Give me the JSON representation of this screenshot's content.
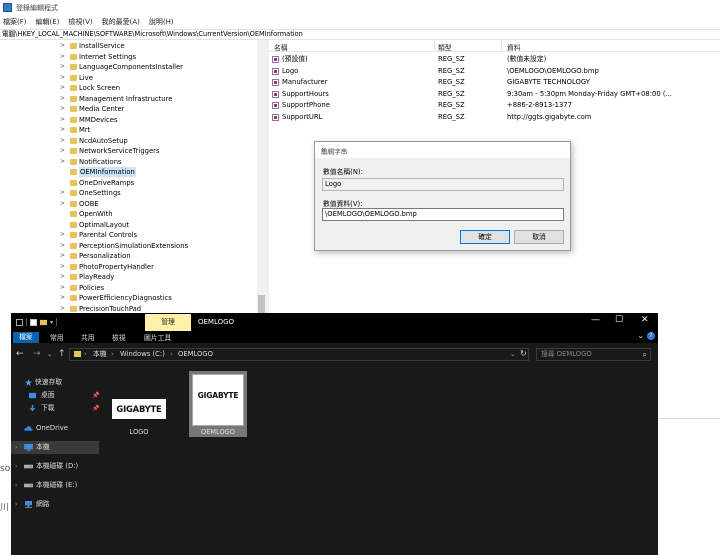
{
  "regedit": {
    "title": "登錄編輯程式",
    "menu": [
      "檔案(F)",
      "編輯(E)",
      "檢視(V)",
      "我的最愛(A)",
      "說明(H)"
    ],
    "address": "電腦\\HKEY_LOCAL_MACHINE\\SOFTWARE\\Microsoft\\Windows\\CurrentVersion\\OEMInformation",
    "tree": [
      {
        "label": "InstallService",
        "selected": false
      },
      {
        "label": "Internet Settings",
        "selected": false
      },
      {
        "label": "LanguageComponentsInstaller",
        "selected": false
      },
      {
        "label": "Live",
        "selected": false
      },
      {
        "label": "Lock Screen",
        "selected": false
      },
      {
        "label": "Management Infrastructure",
        "selected": false
      },
      {
        "label": "Media Center",
        "selected": false
      },
      {
        "label": "MMDevices",
        "selected": false
      },
      {
        "label": "Mrt",
        "selected": false
      },
      {
        "label": "NcdAutoSetup",
        "selected": false
      },
      {
        "label": "NetworkServiceTriggers",
        "selected": false
      },
      {
        "label": "Notifications",
        "selected": false
      },
      {
        "label": "OEMInformation",
        "selected": true
      },
      {
        "label": "OneDriveRamps",
        "selected": false
      },
      {
        "label": "OneSettings",
        "selected": false
      },
      {
        "label": "OOBE",
        "selected": false
      },
      {
        "label": "OpenWith",
        "selected": false
      },
      {
        "label": "OptimalLayout",
        "selected": false
      },
      {
        "label": "Parental Controls",
        "selected": false
      },
      {
        "label": "PerceptionSimulationExtensions",
        "selected": false
      },
      {
        "label": "Personalization",
        "selected": false
      },
      {
        "label": "PhotoPropertyHandler",
        "selected": false
      },
      {
        "label": "PlayReady",
        "selected": false
      },
      {
        "label": "Policies",
        "selected": false
      },
      {
        "label": "PowerEfficiencyDiagnostics",
        "selected": false
      },
      {
        "label": "PrecisionTouchPad",
        "selected": false
      }
    ],
    "columns": {
      "name": "名稱",
      "type": "類型",
      "data": "資料"
    },
    "values": [
      {
        "name": "(預設值)",
        "type": "REG_SZ",
        "data": "(數值未設定)"
      },
      {
        "name": "Logo",
        "type": "REG_SZ",
        "data": "\\OEMLOGO\\OEMLOGO.bmp"
      },
      {
        "name": "Manufacturer",
        "type": "REG_SZ",
        "data": "GIGABYTE TECHNOLOGY"
      },
      {
        "name": "SupportHours",
        "type": "REG_SZ",
        "data": "9:30am - 5:30pm Monday-Friday GMT+08:00 (..."
      },
      {
        "name": "SupportPhone",
        "type": "REG_SZ",
        "data": "+886-2-8913-1377"
      },
      {
        "name": "SupportURL",
        "type": "REG_SZ",
        "data": "http://ggts.gigabyte.com"
      }
    ]
  },
  "dialog": {
    "title": "編輯字串",
    "value_name_label": "數值名稱(N):",
    "value_name": "Logo",
    "value_data_label": "數值資料(V):",
    "value_data": "\\OEMLOGO\\OEMLOGO.bmp",
    "ok_label": "確定",
    "cancel_label": "取消"
  },
  "background": {
    "frag1": "so",
    "frag2": "川"
  },
  "explorer": {
    "context_tab": "管理",
    "window_title": "OEMLOGO",
    "tabs": [
      "檔案",
      "常用",
      "共用",
      "檢視",
      "圖片工具"
    ],
    "breadcrumb": [
      "本機",
      "Windows (C:)",
      "OEMLOGO"
    ],
    "search_placeholder": "搜尋 OEMLOGO",
    "sidebar": [
      {
        "label": "快速存取",
        "icon": "star-icon"
      },
      {
        "label": "桌面",
        "icon": "desktop-icon"
      },
      {
        "label": "下載",
        "icon": "download-icon"
      },
      {
        "label": "OneDrive",
        "icon": "cloud-icon"
      },
      {
        "label": "本機",
        "icon": "pc-icon"
      },
      {
        "label": "本機磁碟 (D:)",
        "icon": "drive-icon"
      },
      {
        "label": "本機磁碟 (E:)",
        "icon": "drive-icon"
      },
      {
        "label": "網路",
        "icon": "network-icon"
      }
    ],
    "files": [
      {
        "name": "LOGO",
        "logo_text": "GIGABYTE",
        "selected": false
      },
      {
        "name": "OEMLOGO",
        "logo_text": "GIGABYTE",
        "selected": true
      }
    ]
  },
  "colors": {
    "explorer_bg": "#191919",
    "accent": "#0063b1",
    "selection": "#cce4f7",
    "context_tab": "#fff2a8"
  }
}
